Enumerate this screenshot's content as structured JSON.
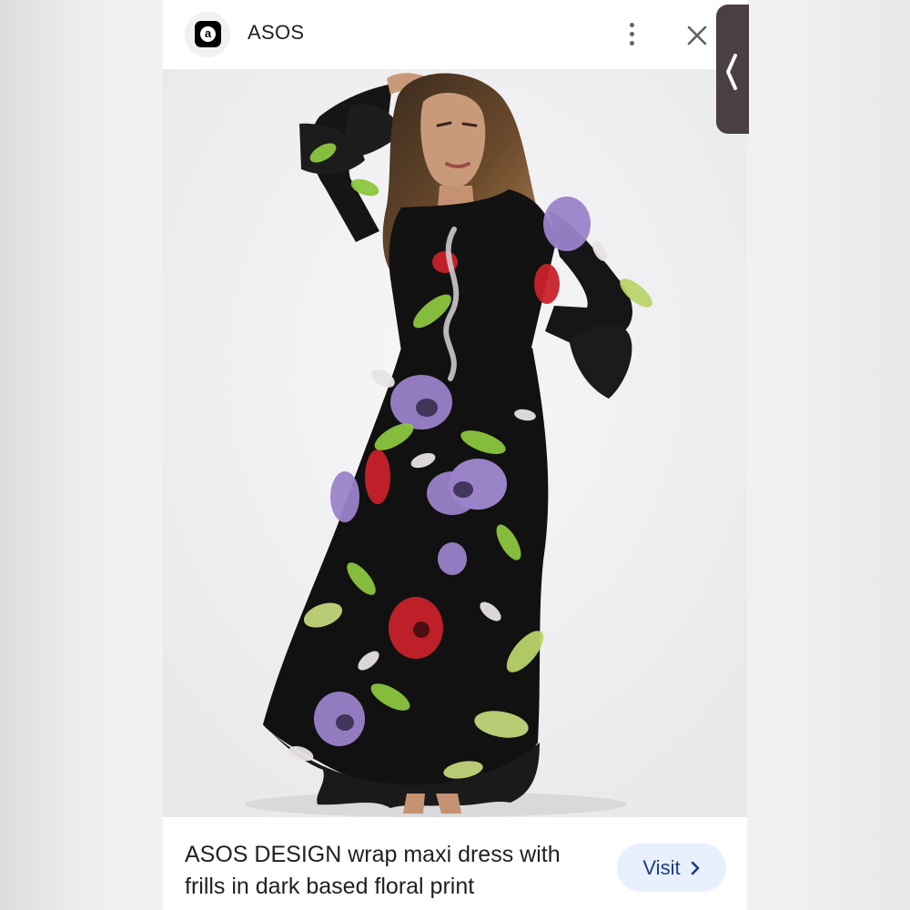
{
  "header": {
    "site_name": "ASOS",
    "site_icon": "asos-logo-icon",
    "site_icon_glyph": "a",
    "more_icon": "more-vert-icon",
    "close_icon": "close-icon"
  },
  "product": {
    "image_alt": "Woman wearing a black floral wrap maxi dress",
    "title": "ASOS DESIGN wrap maxi dress with frills in dark based floral print",
    "visit_label": "Visit",
    "visit_icon": "chevron-right-icon"
  },
  "edge_panel": {
    "icon": "chevron-left-icon"
  },
  "colors": {
    "visit_bg": "#e8f0fe",
    "visit_text": "#1a3c8a",
    "dress_black": "#111111",
    "flower_purple": "#9b82c9",
    "flower_red": "#c8222b",
    "leaf_green": "#8cc63f",
    "edge_tab": "#4a3f42"
  }
}
